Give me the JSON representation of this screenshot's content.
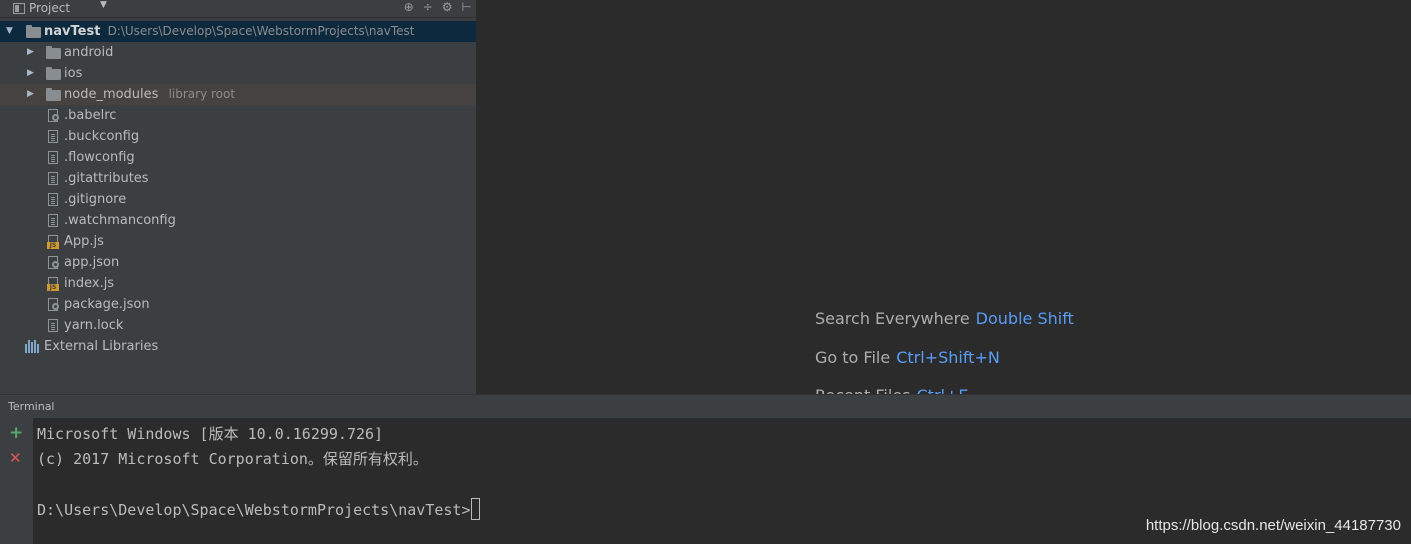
{
  "project_panel": {
    "title": "Project",
    "tools": [
      "⊕",
      "÷",
      "⚙",
      "⊢"
    ],
    "root": {
      "name": "navTest",
      "path": "D:\\Users\\Develop\\Space\\WebstormProjects\\navTest"
    },
    "folders": [
      {
        "name": "android",
        "note": ""
      },
      {
        "name": "ios",
        "note": ""
      },
      {
        "name": "node_modules",
        "note": "library root"
      }
    ],
    "files": [
      {
        "name": ".babelrc",
        "icon": "config-file-icon"
      },
      {
        "name": ".buckconfig",
        "icon": "text-file-icon"
      },
      {
        "name": ".flowconfig",
        "icon": "text-file-icon"
      },
      {
        "name": ".gitattributes",
        "icon": "text-file-icon"
      },
      {
        "name": ".gitignore",
        "icon": "text-file-icon"
      },
      {
        "name": ".watchmanconfig",
        "icon": "text-file-icon"
      },
      {
        "name": "App.js",
        "icon": "js-file-icon"
      },
      {
        "name": "app.json",
        "icon": "config-file-icon"
      },
      {
        "name": "index.js",
        "icon": "js-file-icon"
      },
      {
        "name": "package.json",
        "icon": "config-file-icon"
      },
      {
        "name": "yarn.lock",
        "icon": "text-file-icon"
      }
    ],
    "external": "External Libraries"
  },
  "editor": {
    "hints": [
      {
        "label": "Search Everywhere",
        "key": "Double Shift"
      },
      {
        "label": "Go to File",
        "key": "Ctrl+Shift+N"
      },
      {
        "label": "Recent Files",
        "key": "Ctrl+E"
      }
    ]
  },
  "terminal": {
    "title": "Terminal",
    "add_glyph": "+",
    "close_glyph": "✕",
    "lines": [
      "Microsoft Windows [版本 10.0.16299.726]",
      "(c) 2017 Microsoft Corporation。保留所有权利。",
      "D:\\Users\\Develop\\Space\\WebstormProjects\\navTest>"
    ]
  },
  "watermark": "https://blog.csdn.net/weixin_44187730",
  "colors": {
    "selection": "#0d293e",
    "accent_key": "#589df6",
    "add": "#59a869",
    "close": "#e05555"
  }
}
